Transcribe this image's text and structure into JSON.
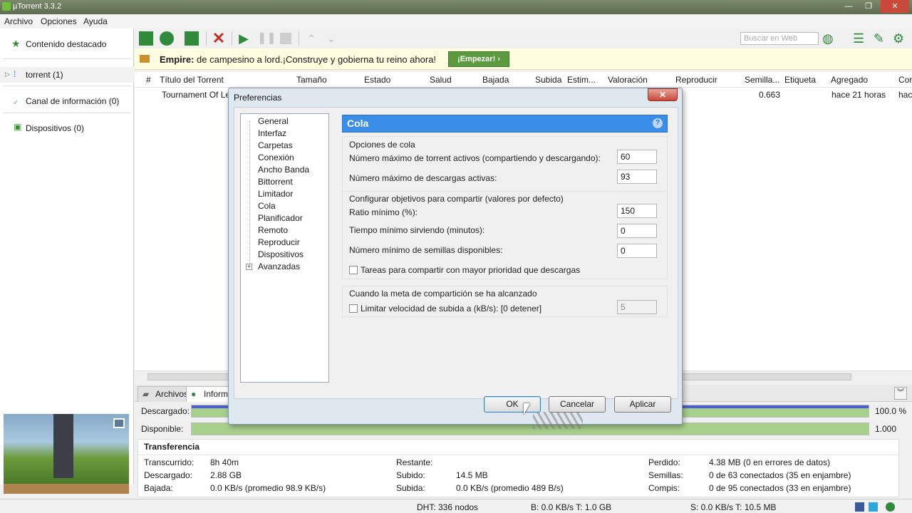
{
  "window": {
    "title": "µTorrent 3.3.2",
    "min": "—",
    "max": "❐",
    "close": "✕"
  },
  "menu": [
    "Archivo",
    "Opciones",
    "Ayuda"
  ],
  "sidebar": {
    "items": [
      {
        "label": "Contenido destacado"
      },
      {
        "label": "torrent (1)"
      },
      {
        "label": "Canal de información (0)"
      },
      {
        "label": "Dispositivos (0)"
      }
    ]
  },
  "toolbar": {
    "search_placeholder": "Buscar en Web"
  },
  "ad": {
    "bold": "Empire:",
    "text": " de campesino a lord.¡Construye y gobierna tu reino ahora!",
    "button": "¡Empezar! ›"
  },
  "list": {
    "headers": [
      "#",
      "Título del Torrent",
      "Tamaño",
      "Estado",
      "Salud",
      "Bajada",
      "Subida",
      "Estim...",
      "Valoración",
      "Reproducir",
      "Semilla...",
      "Etiqueta",
      "Agregado",
      "Cor"
    ],
    "row": {
      "name": "Tournament Of Le",
      "semilla": "0.663",
      "agregado": "hace 21 horas",
      "cor": "hac"
    }
  },
  "tabs": [
    "Archivos",
    "Informa"
  ],
  "progress": [
    {
      "label": "Descargado:",
      "value": "100.0 %",
      "fraction": 1.0
    },
    {
      "label": "Disponible:",
      "value": "1.000",
      "fraction": 1.0
    }
  ],
  "transfer": {
    "title": "Transferencia",
    "col1": [
      {
        "k": "Transcurrido:",
        "v": "8h 40m"
      },
      {
        "k": "Descargado:",
        "v": "2.88 GB"
      },
      {
        "k": "Bajada:",
        "v": "0.0 KB/s (promedio 98.9 KB/s)"
      }
    ],
    "col2": [
      {
        "k": "Restante:",
        "v": ""
      },
      {
        "k": "Subido:",
        "v": "14.5 MB"
      },
      {
        "k": "Subida:",
        "v": "0.0 KB/s (promedio 489 B/s)"
      }
    ],
    "col3": [
      {
        "k": "Perdido:",
        "v": "4.38 MB (0 en errores de datos)"
      },
      {
        "k": "Semillas:",
        "v": "0 de 63 conectados (35 en enjambre)"
      },
      {
        "k": "Compis:",
        "v": "0 de 95 conectados (33 en enjambre)"
      }
    ]
  },
  "status": {
    "dht": "DHT: 336 nodos",
    "b": "B: 0.0 KB/s T: 1.0 GB",
    "s": "S: 0.0 KB/s T: 10.5 MB"
  },
  "dialog": {
    "title": "Preferencias",
    "close": "✕",
    "tree": [
      "General",
      "Interfaz",
      "Carpetas",
      "Conexión",
      "Ancho Banda",
      "Bittorrent",
      "Limitador",
      "Cola",
      "Planificador",
      "Remoto",
      "Reproducir",
      "Dispositivos",
      "Avanzadas"
    ],
    "panel_title": "Cola",
    "help": "?",
    "g1": {
      "title": "Opciones de cola",
      "l1": "Número máximo de torrent activos (compartiendo y descargando):",
      "v1": "60",
      "l2": "Número máximo de descargas activas:",
      "v2": "93"
    },
    "g2": {
      "title": "Configurar objetivos para compartir (valores por defecto)",
      "l1": "Ratio mínimo (%):",
      "v1": "150",
      "l2": "Tiempo mínimo sirviendo (minutos):",
      "v2": "0",
      "l3": "Número mínimo de semillas disponibles:",
      "v3": "0",
      "chk": "Tareas para compartir con mayor prioridad que descargas"
    },
    "g3": {
      "title": "Cuando la meta de compartición se ha alcanzado",
      "chk": "Limitar velocidad de subida a (kB/s): [0 detener]",
      "v": "5"
    },
    "ok": "OK",
    "cancel": "Cancelar",
    "apply": "Aplicar"
  }
}
